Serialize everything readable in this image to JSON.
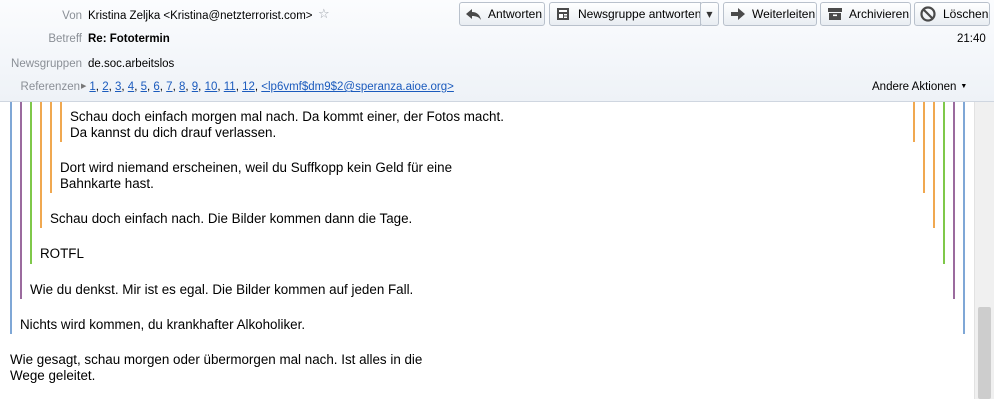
{
  "header": {
    "from_label": "Von",
    "from_value": "Kristina Zeljka <Kristina@netzterrorist.com>",
    "subject_label": "Betreff",
    "subject_value": "Re: Fototermin",
    "newsgroups_label": "Newsgruppen",
    "newsgroups_value": "de.soc.arbeitslos",
    "references_label": "Referenzen",
    "references": [
      "1",
      "2",
      "3",
      "4",
      "5",
      "6",
      "7",
      "8",
      "9",
      "10",
      "11",
      "12"
    ],
    "reference_msgid": "<lp6vmf$dm9$2@speranza.aioe.org>",
    "time": "21:40",
    "other_actions": "Andere Aktionen"
  },
  "toolbar": {
    "reply": "Antworten",
    "reply_newsgroup": "Newsgruppe antworten",
    "forward": "Weiterleiten",
    "archive": "Archivieren",
    "delete": "Löschen"
  },
  "message": {
    "q5": [
      "Schau doch einfach morgen mal nach. Da kommt einer, der Fotos macht.",
      "Da kannst du dich drauf verlassen."
    ],
    "q4": [
      "Dort wird niemand erscheinen, weil du Suffkopp kein Geld für eine",
      "Bahnkarte hast."
    ],
    "q3": "Schau doch einfach nach. Die Bilder kommen dann die Tage.",
    "q2": "ROTFL",
    "q1": "Wie du denkst. Mir ist es egal. Die Bilder kommen auf jeden Fall.",
    "q0": "Nichts wird kommen, du krankhafter Alkoholiker.",
    "reply": [
      "Wie gesagt, schau morgen oder übermorgen mal nach. Ist alles in die",
      "Wege geleitet."
    ]
  },
  "colors": {
    "quote_blue": "#7fa7d6",
    "quote_purple": "#9b6b9e",
    "quote_green": "#7fc84a",
    "quote_orange": "#f0a850",
    "link": "#1b5bbd"
  },
  "icons": {
    "reply": "reply-arrow-icon",
    "reply_newsgroup": "newsgroup-icon",
    "forward": "forward-arrow-icon",
    "archive": "archive-box-icon",
    "delete": "delete-circle-icon",
    "star": "star-icon"
  }
}
